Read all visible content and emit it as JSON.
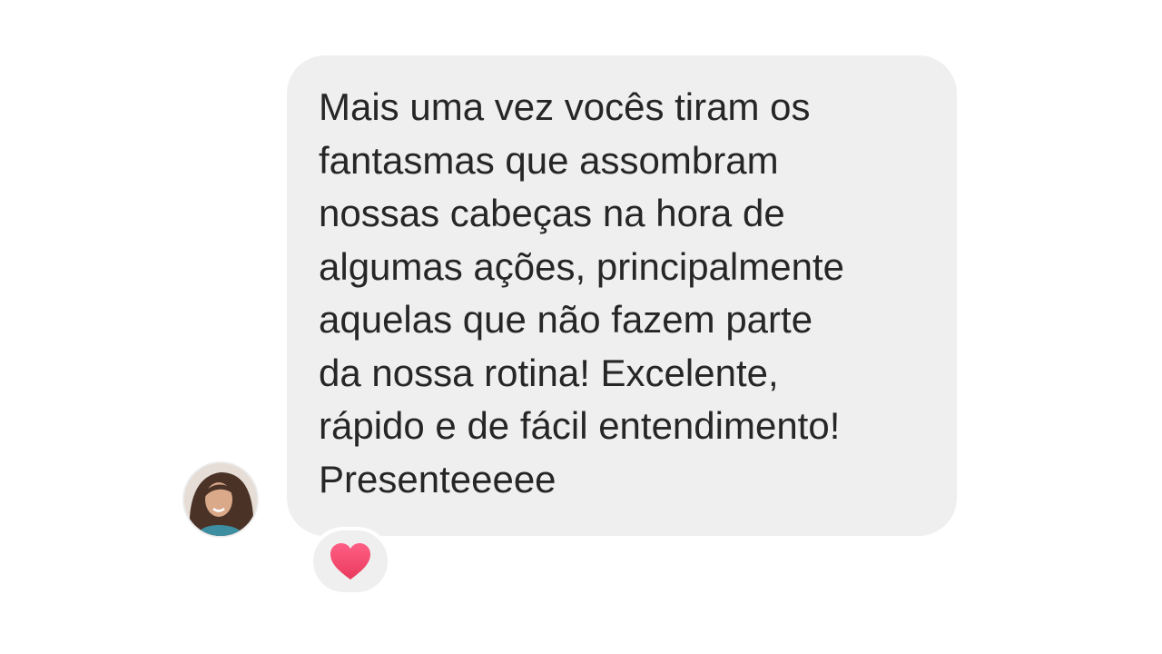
{
  "message": {
    "text": "Mais uma vez vocês tiram os\nfantasmas que assombram\nnossas cabeças na hora de\nalgumas ações, principalmente\naquelas que não fazem parte\nda nossa rotina! Excelente,\nrápido e de fácil entendimento!\nPresenteeeee",
    "bubble_color": "#efefef",
    "text_color": "#262626"
  },
  "sender": {
    "avatar_icon": "profile-photo"
  },
  "reaction": {
    "icon": "heart-icon",
    "color": "#f0506e"
  }
}
